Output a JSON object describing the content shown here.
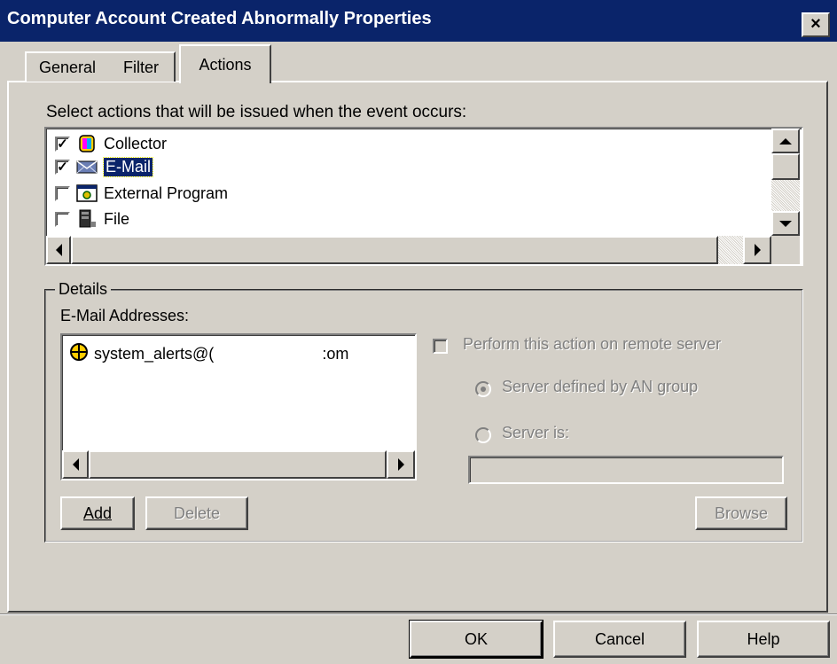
{
  "window": {
    "title": "Computer Account Created Abnormally Properties",
    "close_label": "×"
  },
  "tabs": [
    {
      "label": "General",
      "active": false
    },
    {
      "label": "Filter",
      "active": false
    },
    {
      "label": "Actions",
      "active": true
    }
  ],
  "actions_panel": {
    "instruction": "Select actions that will be issued when the event occurs:",
    "items": [
      {
        "label": "Collector",
        "checked": true,
        "icon": "collector-icon",
        "selected": false
      },
      {
        "label": "E-Mail",
        "checked": true,
        "icon": "email-icon",
        "selected": true
      },
      {
        "label": "External Program",
        "checked": false,
        "icon": "external-program-icon",
        "selected": false
      },
      {
        "label": "File",
        "checked": false,
        "icon": "file-icon",
        "selected": false
      }
    ]
  },
  "details": {
    "legend": "Details",
    "email_label": "E-Mail Addresses:",
    "emails": [
      {
        "prefix": "system_alerts@(",
        "suffix": ":om",
        "icon": "email-address-icon"
      }
    ],
    "add_button": "Add",
    "delete_button": "Delete",
    "remote_checkbox_label": "Perform this action on remote server",
    "radio_group_label": "Server defined by AN group",
    "radio_server_label": "Server is:",
    "server_value": "",
    "browse_button": "Browse"
  },
  "footer": {
    "ok": "OK",
    "cancel": "Cancel",
    "help": "Help"
  },
  "colors": {
    "titlebar": "#0a246a",
    "face": "#d4d0c8",
    "selection": "#0a246a"
  }
}
